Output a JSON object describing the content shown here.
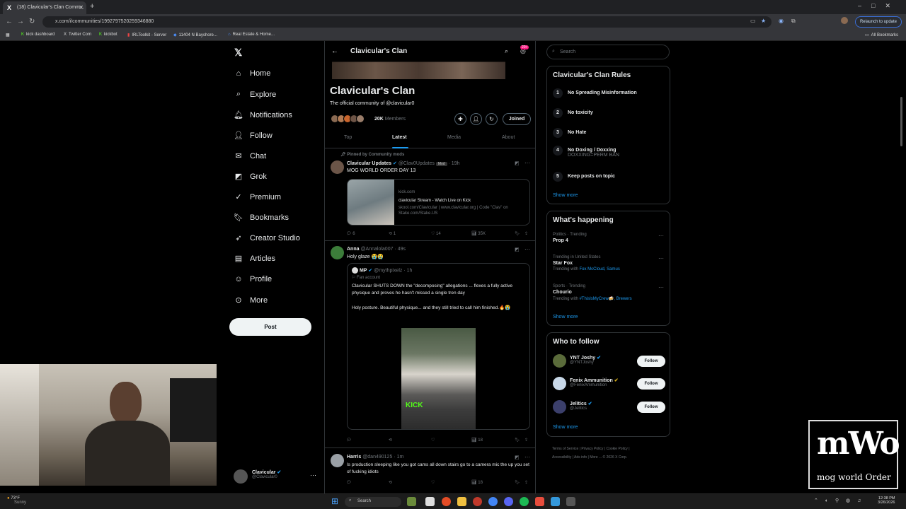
{
  "browser": {
    "tab_title": "(18) Clavicular's Clan Comm...",
    "url": "x.com/i/communities/1992797520259346880",
    "relaunch_label": "Relaunch to update",
    "bookmarks": [
      "kick dashboard",
      "Twitter Com",
      "kickbot",
      "IRLToolkit - Server",
      "11404 N Bayshore...",
      "Real Estate & Home..."
    ],
    "all_bookmarks": "All Bookmarks"
  },
  "nav": {
    "items": [
      "Home",
      "Explore",
      "Notifications",
      "Follow",
      "Chat",
      "Grok",
      "Premium",
      "Bookmarks",
      "Creator Studio",
      "Articles",
      "Profile",
      "More"
    ],
    "post_label": "Post",
    "account_name": "Clavicular",
    "account_handle": "@Clavicular0"
  },
  "community": {
    "header_title": "Clavicular's Clan",
    "badge": "20+",
    "title": "Clavicular's Clan",
    "description": "The official community of @clavicular0",
    "members_count": "20K",
    "members_label": "Members",
    "joined_label": "Joined",
    "tabs": [
      "Top",
      "Latest",
      "Media",
      "About"
    ],
    "active_tab": "Latest"
  },
  "posts": {
    "pinned_label": "Pinned by Community mods",
    "p1": {
      "name": "Clavicular Updates",
      "handle": "@Clav0Updates",
      "mod_badge": "Mod",
      "time": "· 19h",
      "text": "MOG WORLD ORDER DAY 13",
      "card_domain": "kick.com",
      "card_title": "clavicular Stream - Watch Live on Kick",
      "card_desc": "skool.com/Clavicular | www.clavicular.org | Code \"Clav\" on Stake.com/Stake.US",
      "replies": "6",
      "reposts": "1",
      "likes": "14",
      "views": "35K"
    },
    "p2": {
      "name": "Anna",
      "handle": "@Annalola007",
      "time": "· 49s",
      "text": "Holy glaze 😭😭",
      "quote_name": "MP",
      "quote_handle": "@mythpixelz",
      "quote_time": "· 1h",
      "quote_label": "Fan account",
      "quote_text1": "Clavicular SHUTS DOWN the \"decomposing\" allegations ... flexes a fully active physique and proves he hasn't missed a single tren day",
      "quote_text2": "Holy posture. Beautiful physique... and they still tried to call him finished.🔥😭",
      "image_watermark": "KICK",
      "views": "18"
    },
    "p3": {
      "name": "Harris",
      "handle": "@dan490125",
      "time": "· 1m",
      "text": "Is production sleeping like you got cams all down stairs go to a camera mic the up you set of fucking idiots",
      "views": "18"
    }
  },
  "right": {
    "search_placeholder": "Search",
    "rules_title": "Clavicular's Clan Rules",
    "rules": [
      {
        "n": "1",
        "title": "No Spreading Misinformation",
        "sub": ""
      },
      {
        "n": "2",
        "title": "No toxicity",
        "sub": ""
      },
      {
        "n": "3",
        "title": "No Hate",
        "sub": ""
      },
      {
        "n": "4",
        "title": "No Doxing / Doxxing",
        "sub": "DOXXING=PERM BAN"
      },
      {
        "n": "5",
        "title": "Keep posts on topic",
        "sub": ""
      }
    ],
    "show_more": "Show more",
    "happening_title": "What's happening",
    "trends": [
      {
        "cat": "Politics · Trending",
        "title": "Prop 4",
        "extra_prefix": "",
        "extra": ""
      },
      {
        "cat": "Trending in United States",
        "title": "Star Fox",
        "extra_prefix": "Trending with ",
        "extra": "Fox McCloud, Samus"
      },
      {
        "cat": "Sports · Trending",
        "title": "Chourio",
        "extra_prefix": "Trending with ",
        "extra": "#ThisIsMyCrew🍻, Brewers"
      }
    ],
    "who_title": "Who to follow",
    "who": [
      {
        "name": "YNT Joshy",
        "handle": "@YNTJoshy"
      },
      {
        "name": "Fenix Ammunition",
        "handle": "@FenixAmmunition"
      },
      {
        "name": "Jelitics",
        "handle": "@Jelitics"
      }
    ],
    "follow_label": "Follow",
    "footer": [
      "Terms of Service",
      "Privacy Policy",
      "Cookie Policy",
      "Accessibility",
      "Ads info",
      "More ...",
      "© 2026 X Corp."
    ]
  },
  "overlay": {
    "logo_big": "mWo",
    "logo_text": "mog world Order"
  },
  "taskbar": {
    "weather_temp": "73°F",
    "weather_desc": "Sunny",
    "search_label": "Search",
    "time": "12:38 PM",
    "date": "3/26/2026"
  }
}
